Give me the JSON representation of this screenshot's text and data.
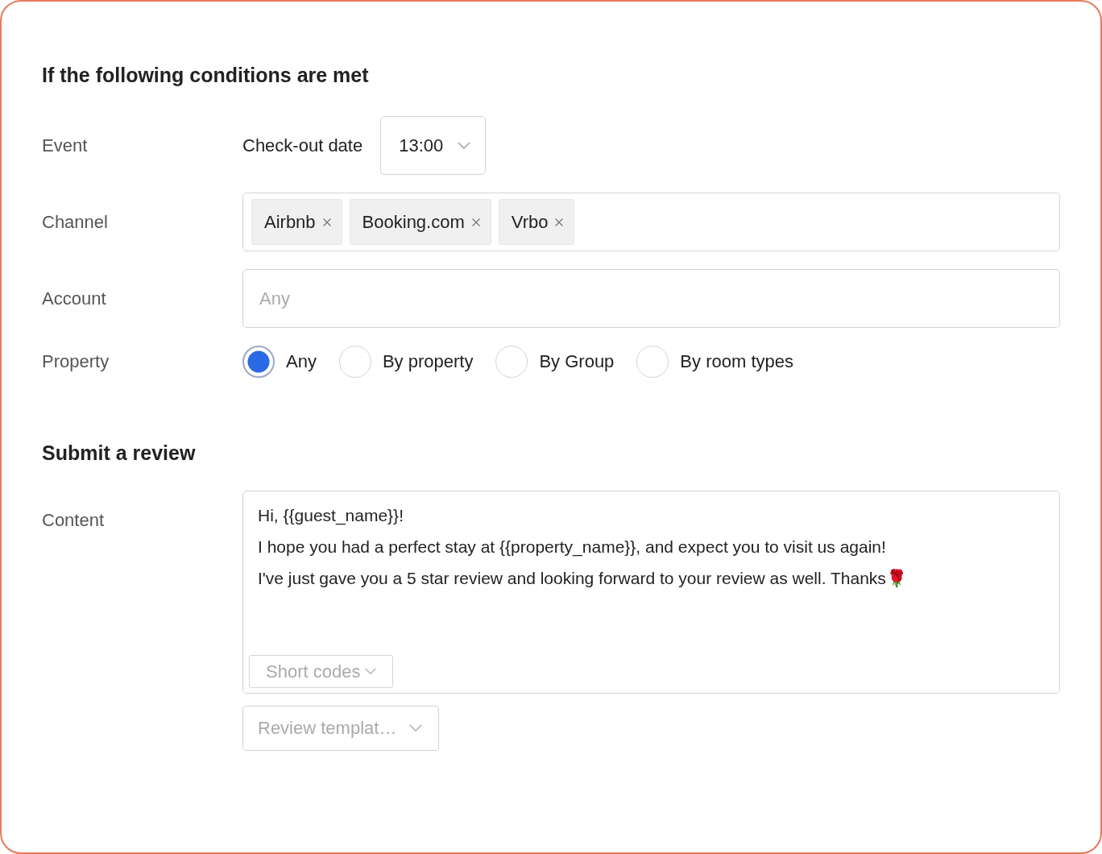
{
  "conditions": {
    "heading": "If the following conditions are met",
    "event": {
      "label": "Event",
      "value": "Check-out date",
      "time": "13:00"
    },
    "channel": {
      "label": "Channel",
      "tags": [
        {
          "text": "Airbnb"
        },
        {
          "text": "Booking.com"
        },
        {
          "text": "Vrbo"
        }
      ]
    },
    "account": {
      "label": "Account",
      "placeholder": "Any"
    },
    "property": {
      "label": "Property",
      "options": [
        {
          "label": "Any",
          "selected": true
        },
        {
          "label": "By property",
          "selected": false
        },
        {
          "label": "By Group",
          "selected": false
        },
        {
          "label": "By room types",
          "selected": false
        }
      ]
    }
  },
  "review": {
    "heading": "Submit a review",
    "content": {
      "label": "Content",
      "lines": [
        "Hi, {{guest_name}}!",
        "I hope you had a perfect stay at {{property_name}}, and expect you to visit us again!",
        "I've just gave you a 5 star review and looking forward to your review as well. Thanks🌹"
      ]
    },
    "short_codes": "Short codes",
    "template": "Review templat…"
  }
}
